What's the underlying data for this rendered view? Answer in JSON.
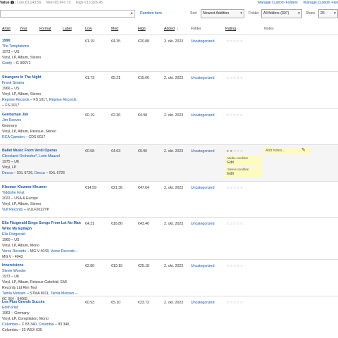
{
  "top": {
    "value_label": "Value",
    "low": "Low €3,143.56",
    "med": "Med €5,947.72",
    "high": "High €13,926.45",
    "manage_folders": "Manage Custom Folders",
    "manage_fields": "Manage Custom Fields"
  },
  "controls": {
    "search_placeholder": "",
    "random": "Random item",
    "sort_label": "Sort",
    "sort_value": "Newest Addition",
    "folder_label": "Folder",
    "folder_value": "All folders (307)",
    "show_label": "Show",
    "show_value": "25"
  },
  "headers": {
    "artist": "Artist",
    "year": "Year",
    "format": "Format",
    "label": "Label",
    "low": "Low",
    "med": "Med",
    "high": "High",
    "added": "Added",
    "folder": "Folder",
    "rating": "Rating",
    "notes": "Notes"
  },
  "rows": [
    {
      "title": "1990",
      "artist": "The Temptations",
      "l1": "1973 – US",
      "l2": "Vinyl, LP, Album, Stereo",
      "label": "Gordy",
      "cat": " – G 966V1",
      "label2": "",
      "cat2": "",
      "low": "€1.19",
      "med": "€4.35",
      "high": "€20.88",
      "added": "3. okt. 2023",
      "folder": "Uncategorized",
      "stars": "☆☆☆☆☆",
      "stars_on": ""
    },
    {
      "title": "Strangers In The Night",
      "artist": "Frank Sinatra",
      "l1": "1966 – US",
      "l2": "Vinyl, LP, Album, Stereo",
      "label": "Reprise Records",
      "cat": " – FS 1017, ",
      "label2": "Reprise Records",
      "cat2": "– FS-1017",
      "low": "€1.73",
      "med": "€5.21",
      "high": "€15.66",
      "added": "2. okt. 2023",
      "folder": "Uncategorized",
      "stars": "☆☆☆☆☆",
      "stars_on": ""
    },
    {
      "title": "Gentleman Jim",
      "artist": "Jim Reeves",
      "l1": "Germany",
      "l2": "Vinyl, LP, Album, Reissue, Stereo",
      "label": "RCA Camden",
      "cat": " – CDS 6017",
      "label2": "",
      "cat2": "",
      "low": "€0.19",
      "med": "€2.36",
      "high": "€4.98",
      "added": "2. okt. 2023",
      "folder": "Uncategorized",
      "stars": "☆☆☆☆☆",
      "stars_on": ""
    },
    {
      "title": "Ballet Music From Verdi Operas",
      "artist": "Cleveland Orchestra*, Lorin Maazel",
      "l1": "1975 – UK",
      "l2": "Vinyl, LP",
      "label": "Decca",
      "cat": " – SXL 6726, ",
      "label2": "Decca",
      "cat2": " – SXL 6726",
      "low": "€0.58",
      "med": "€4.63",
      "high": "€9.90",
      "added": "2. okt. 2023",
      "folder": "Uncategorized",
      "stars": "☆☆☆",
      "stars_on": "★★"
    },
    {
      "title": "Klezmer Klezmer Klezmer",
      "artist": "Yiddishe Firat",
      "l1": "2022 – USA & Europe",
      "l2": "Vinyl, LP, Album, Stereo",
      "label": "Vulf Records",
      "cat": " – VULF2022YP",
      "label2": "",
      "cat2": "",
      "low": "€14.59",
      "med": "€21.36",
      "high": "€47.64",
      "added": "2. okt. 2023",
      "folder": "Uncategorized",
      "stars": "☆☆☆☆☆",
      "stars_on": ""
    },
    {
      "title": "Ella Fitzgerald Sings Songs From Let No Man Write My Epitaph",
      "artist": "Ella Fitzgerald",
      "l1": "1960 – US",
      "l2": "Vinyl, LP, Album, Mono",
      "label": "Verve Records",
      "cat": " – MG V-4043, ",
      "label2": "Verve Records",
      "cat2": " – MG V - 4043",
      "low": "€4.31",
      "med": "€16.86",
      "high": "€43.46",
      "added": "2. okt. 2023",
      "folder": "Uncategorized",
      "stars": "☆☆☆☆☆",
      "stars_on": ""
    },
    {
      "title": "Innervisions",
      "artist": "Stevie Wonder",
      "l1": "1973 – UK",
      "l2": "Vinyl, LP, Album, Reissue Gatefold, EMI Records Ltd Rim Text",
      "label": "Tamla Motown",
      "cat": " – STMA 8011, ",
      "label2": "Tamla Motown",
      "cat2": " – 0C 064 - 94665",
      "low": "€2.80",
      "med": "€10.15",
      "high": "€25.18",
      "added": "2. okt. 2023",
      "folder": "Uncategorized",
      "stars": "☆☆☆☆☆",
      "stars_on": ""
    },
    {
      "title": "Les Plus Grands Succès",
      "artist": "Edith Piaf",
      "l1": "1963 – Germany",
      "l2": "Vinyl, LP, Compilation, Mono",
      "label": "Columbia",
      "cat": " – C 83 340, ",
      "label2": "Columbia",
      "cat2": " – 83 340, Columbia – 33 WSX 635",
      "low": "€0.93",
      "med": "€5.10",
      "high": "€23.72",
      "added": "2. okt. 2023",
      "folder": "Uncategorized",
      "stars": "☆☆☆☆☆",
      "stars_on": ""
    }
  ],
  "notes": {
    "add": "Add notes...",
    "media_label": "Media condition",
    "media_edit": "Edit",
    "sleeve_label": "Sleeve condition",
    "sleeve_edit": "Edit"
  }
}
